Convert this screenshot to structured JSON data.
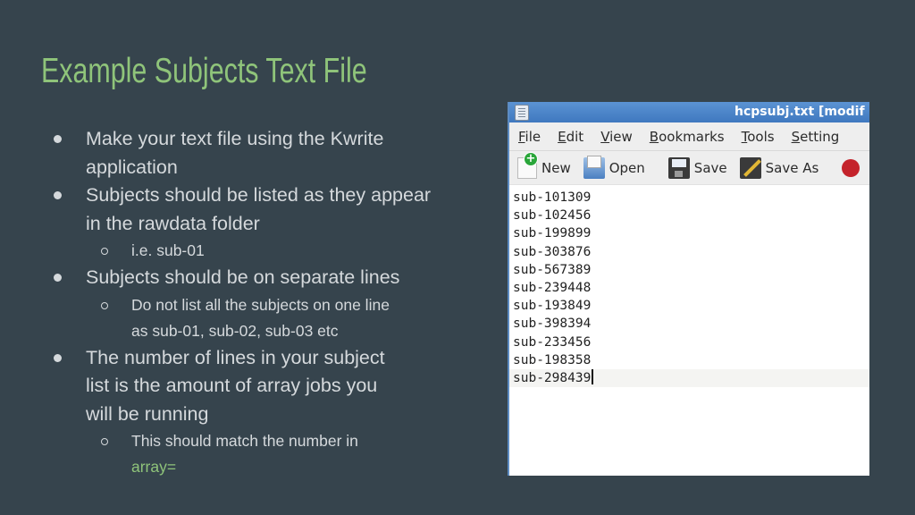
{
  "slide": {
    "title": "Example Subjects Text File",
    "accent_color": "#8fc47a",
    "background_color": "#36444d",
    "bullets": [
      {
        "level": 1,
        "text": "Make your text file using the Kwrite application"
      },
      {
        "level": 1,
        "text": "Subjects should be listed as they appear in the rawdata folder"
      },
      {
        "level": 2,
        "text": "i.e. sub-01"
      },
      {
        "level": 1,
        "text": "Subjects should be on separate lines"
      },
      {
        "level": 2,
        "text": "Do not list all the subjects on one line as sub-01, sub-02, sub-03 etc"
      },
      {
        "level": 1,
        "text": "The number of lines in your subject list is the amount of array jobs you will be running"
      },
      {
        "level": 2,
        "text": "This should match the number in",
        "accent_text": "array="
      }
    ]
  },
  "kwrite": {
    "window_title": "hcpsubj.txt [modif",
    "menu": [
      {
        "label": "File",
        "mnemonic": "F",
        "rest": "ile"
      },
      {
        "label": "Edit",
        "mnemonic": "E",
        "rest": "dit"
      },
      {
        "label": "View",
        "mnemonic": "V",
        "rest": "iew"
      },
      {
        "label": "Bookmarks",
        "mnemonic": "B",
        "rest": "ookmarks"
      },
      {
        "label": "Tools",
        "mnemonic": "T",
        "rest": "ools"
      },
      {
        "label": "Settings",
        "mnemonic": "S",
        "rest": "etting"
      }
    ],
    "toolbar": {
      "new_label": "New",
      "open_label": "Open",
      "save_label": "Save",
      "save_as_label": "Save As"
    },
    "lines": [
      "sub-101309",
      "sub-102456",
      "sub-199899",
      "sub-303876",
      "sub-567389",
      "sub-239448",
      "sub-193849",
      "sub-398394",
      "sub-233456",
      "sub-198358",
      "sub-298439"
    ]
  }
}
